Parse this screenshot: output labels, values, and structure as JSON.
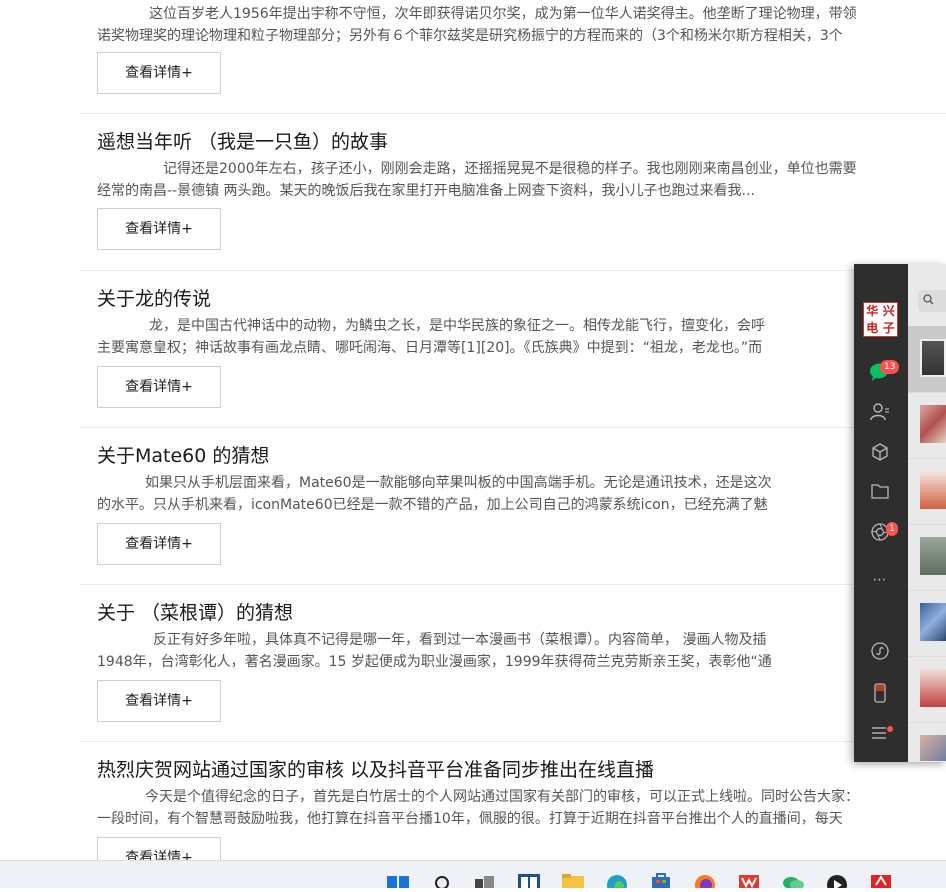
{
  "articles": [
    {
      "title": "",
      "excerpt_lines": [
        "这位百岁老人1956年提出宇称不守恒，次年即获得诺贝尔奖，成为第一位华人诺奖得主。他垄断了理论物理，带领",
        "诺奖物理奖的理论物理和粒子物理部分；另外有６个菲尔兹奖是研究杨振宁的方程而来的（3个和杨米尔斯方程相关，3个"
      ],
      "button": "查看详情+"
    },
    {
      "title": "遥想当年听 （我是一只鱼）的故事",
      "excerpt_lines": [
        "记得还是2000年左右，孩子还小，刚刚会走路，还摇摇晃晃不是很稳的样子。我也刚刚来南昌创业，单位也需要",
        "经常的南昌--景德镇 两头跑。某天的晚饭后我在家里打开电脑准备上网查下资料，我小儿子也跑过来看我..."
      ],
      "button": "查看详情+"
    },
    {
      "title": "关于龙的传说",
      "excerpt_lines": [
        "龙，是中国古代神话中的动物，为鳞虫之长，是中华民族的象征之一。相传龙能飞行，擅变化，会呼",
        "主要寓意皇权；神话故事有画龙点睛、哪吒闹海、日月潭等[1][20]。《氏族典》中提到：“祖龙，老龙也。”而"
      ],
      "button": "查看详情+"
    },
    {
      "title": "关于Mate60 的猜想",
      "excerpt_lines": [
        "如果只从手机层面来看，Mate60是一款能够向苹果叫板的中国高端手机。无论是通讯技术，还是这次",
        "的水平。只从手机来看，iconMate60已经是一款不错的产品，加上公司自己的鸿蒙系统icon，已经充满了魅"
      ],
      "button": "查看详情+"
    },
    {
      "title": "关于 （菜根谭）的猜想",
      "excerpt_lines": [
        "反正有好多年啦，具体真不记得是哪一年，看到过一本漫画书（菜根谭）。内容简单， 漫画人物及插",
        "1948年，台湾彰化人，著名漫画家。15 岁起便成为职业漫画家，1999年获得荷兰克劳斯亲王奖，表彰他“通"
      ],
      "button": "查看详情+"
    },
    {
      "title": "热烈庆贺网站通过国家的审核 以及抖音平台准备同步推出在线直播",
      "excerpt_lines": [
        "今天是个值得纪念的日子，首先是白竹居士的个人网站通过国家有关部门的审核，可以正式上线啦。同时公告大家：",
        "一段时间，有个智慧哥鼓励啦我，他打算在抖音平台播10年，佩服的很。打算于近期在抖音平台推出个人的直播间，每天"
      ],
      "button": "查看详情+"
    }
  ],
  "wechat": {
    "avatar_chars": [
      "华",
      "兴",
      "电",
      "子"
    ],
    "chat_badge": "13",
    "moments_badge": "1",
    "search_icon": "search-icon",
    "colors": {
      "sidebar": "#2e2e2e",
      "active": "#07c160",
      "badge": "#fa5151"
    }
  },
  "taskbar": {
    "icons": [
      "windows-start-icon",
      "search-icon",
      "task-view-icon",
      "widgets-icon",
      "file-explorer-icon",
      "edge-icon",
      "store-icon",
      "firefox-icon",
      "wps-icon",
      "wechat-icon",
      "media-player-icon",
      "app-icon"
    ]
  }
}
